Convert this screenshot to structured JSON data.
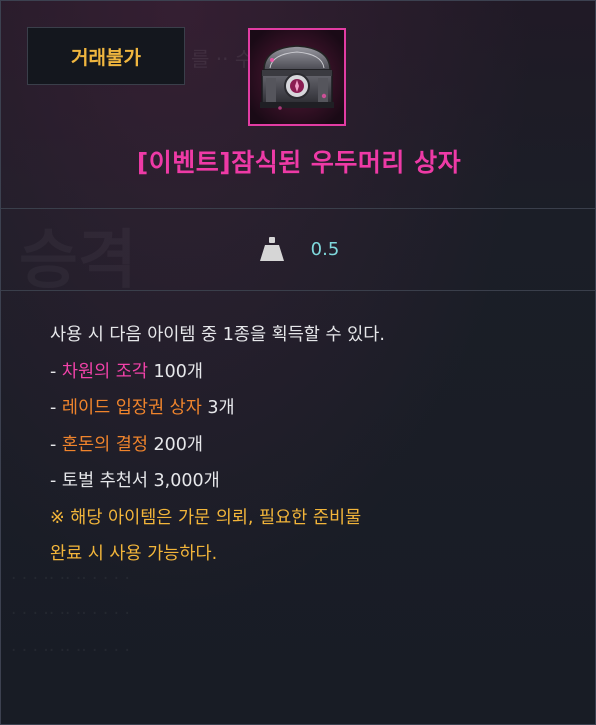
{
  "badge": {
    "trade_status": "거래불가"
  },
  "item": {
    "icon": "treasure-chest-icon",
    "name": "[이벤트]잠식된 우두머리 상자",
    "name_color": "#ee3aa6"
  },
  "weight": {
    "icon": "weight-icon",
    "value": "0.5"
  },
  "description": {
    "intro": "사용 시 다음 아이템 중 1종을 획득할 수 있다.",
    "rewards": [
      {
        "prefix": "- ",
        "name": "차원의 조각",
        "amount": " 100개",
        "color": "#f242a9"
      },
      {
        "prefix": "- ",
        "name": "레이드 입장권 상자",
        "amount": " 3개",
        "color": "#f0842c"
      },
      {
        "prefix": "- ",
        "name": "혼돈의 결정",
        "amount": " 200개",
        "color": "#f0842c"
      },
      {
        "prefix": "- ",
        "name": "토벌 추천서",
        "amount": " 3,000개",
        "color": "#e6e7ea"
      }
    ],
    "note_line1": "※ 해당 아이템은 가문 의뢰, 필요한 준비물",
    "note_line2": "완료 시 사용 가능하다."
  }
}
